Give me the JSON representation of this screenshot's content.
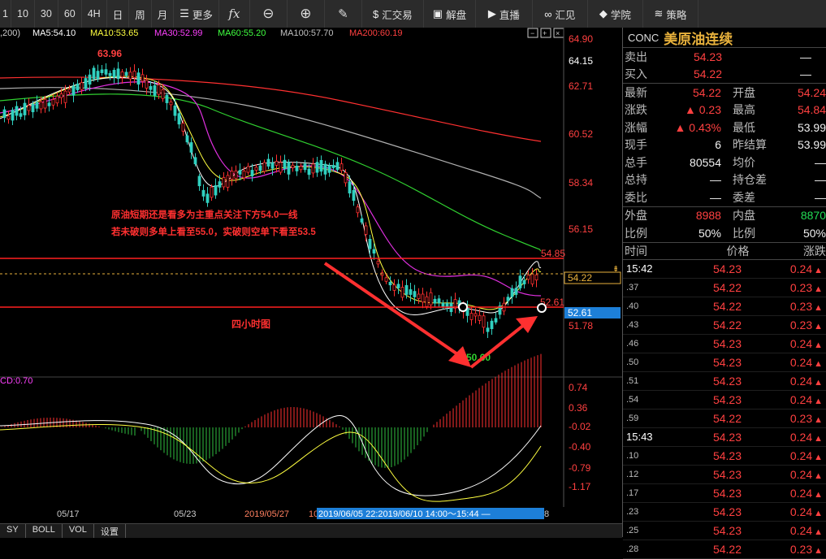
{
  "toolbar": {
    "items": [
      "1",
      "10",
      "30",
      "60",
      "4H",
      "日",
      "周",
      "月"
    ],
    "more": "更多",
    "fx": "fx",
    "trade": "汇交易",
    "analysis": "解盘",
    "live": "直播",
    "huijian": "汇见",
    "school": "学院",
    "strategy": "策略"
  },
  "ma_legend": {
    "prefix": ",200)",
    "ma5": "MA5:54.10",
    "ma10": "MA10:53.65",
    "ma30": "MA30:52.99",
    "ma60": "MA60:55.20",
    "ma100": "MA100:57.70",
    "ma200": "MA200:60.19",
    "colors": {
      "ma5": "#ffffff",
      "ma10": "#ffff40",
      "ma30": "#ff40ff",
      "ma60": "#40ff40",
      "ma100": "#c0c0c0",
      "ma200": "#ff4040"
    }
  },
  "price_axis": [
    "64.90",
    "64.15",
    "62.71",
    "60.52",
    "58.34",
    "56.15",
    "54.22",
    "52.61",
    "51.78"
  ],
  "macd_axis": [
    "0.74",
    "0.36",
    "-0.02",
    "-0.40",
    "-0.79",
    "-1.17"
  ],
  "macd_label": "CD:0.70",
  "annotations": {
    "high": "63.96",
    "low": "50.60",
    "level_upper": "54.85",
    "level_lower": "52.61",
    "text1": "原油短期还是看多为主重点关注下方54.0一线",
    "text2": "若未破则多单上看至55.0，实破则空单下看至53.5",
    "text3": "四小时图"
  },
  "x_axis": {
    "d1": "05/17",
    "d2": "05/23",
    "d3": "2019/05/27",
    "d3b": "10",
    "range": "2019/06/05 22:2019/06/10 14:00～15:44 —",
    "d4": "8"
  },
  "bottom_tabs": [
    "SY",
    "BOLL",
    "VOL",
    "设置"
  ],
  "quote": {
    "code": "CONC",
    "name": "美原油连续",
    "sell_label": "卖出",
    "sell": "54.23",
    "sell_vol": "—",
    "buy_label": "买入",
    "buy": "54.22",
    "buy_vol": "—",
    "rows": [
      {
        "l1": "最新",
        "v1": "54.22",
        "c1": "red",
        "l2": "开盘",
        "v2": "54.24",
        "c2": "red"
      },
      {
        "l1": "涨跌",
        "v1": "▲ 0.23",
        "c1": "red",
        "l2": "最高",
        "v2": "54.84",
        "c2": "red"
      },
      {
        "l1": "涨幅",
        "v1": "▲ 0.43%",
        "c1": "red",
        "l2": "最低",
        "v2": "53.99",
        "c2": "white"
      },
      {
        "l1": "现手",
        "v1": "6",
        "c1": "white",
        "l2": "昨结算",
        "v2": "53.99",
        "c2": "white"
      },
      {
        "l1": "总手",
        "v1": "80554",
        "c1": "white",
        "l2": "均价",
        "v2": "—",
        "c2": "white"
      },
      {
        "l1": "总持",
        "v1": "—",
        "c1": "white",
        "l2": "持仓差",
        "v2": "—",
        "c2": "white"
      },
      {
        "l1": "委比",
        "v1": "—",
        "c1": "white",
        "l2": "委差",
        "v2": "—",
        "c2": "white"
      },
      {
        "l1": "外盘",
        "v1": "8988",
        "c1": "red",
        "l2": "内盘",
        "v2": "8870",
        "c2": "green"
      },
      {
        "l1": "比例",
        "v1": "50%",
        "c1": "white",
        "l2": "比例",
        "v2": "50%",
        "c2": "white"
      }
    ]
  },
  "ticks_header": {
    "time": "时间",
    "price": "价格",
    "chg": "涨跌"
  },
  "ticks": [
    {
      "t": "15:42",
      "big": true,
      "p": "54.23",
      "c": "0.24"
    },
    {
      "t": ".37",
      "big": false,
      "p": "54.22",
      "c": "0.23"
    },
    {
      "t": ".40",
      "big": false,
      "p": "54.22",
      "c": "0.23"
    },
    {
      "t": ".43",
      "big": false,
      "p": "54.22",
      "c": "0.23"
    },
    {
      "t": ".46",
      "big": false,
      "p": "54.23",
      "c": "0.24"
    },
    {
      "t": ".50",
      "big": false,
      "p": "54.23",
      "c": "0.24"
    },
    {
      "t": ".51",
      "big": false,
      "p": "54.23",
      "c": "0.24"
    },
    {
      "t": ".54",
      "big": false,
      "p": "54.23",
      "c": "0.24"
    },
    {
      "t": ".59",
      "big": false,
      "p": "54.22",
      "c": "0.23"
    },
    {
      "t": "15:43",
      "big": true,
      "p": "54.23",
      "c": "0.24"
    },
    {
      "t": ".10",
      "big": false,
      "p": "54.23",
      "c": "0.24"
    },
    {
      "t": ".12",
      "big": false,
      "p": "54.23",
      "c": "0.24"
    },
    {
      "t": ".17",
      "big": false,
      "p": "54.23",
      "c": "0.24"
    },
    {
      "t": ".23",
      "big": false,
      "p": "54.23",
      "c": "0.24"
    },
    {
      "t": ".25",
      "big": false,
      "p": "54.23",
      "c": "0.24"
    },
    {
      "t": ".28",
      "big": false,
      "p": "54.22",
      "c": "0.23"
    }
  ]
}
